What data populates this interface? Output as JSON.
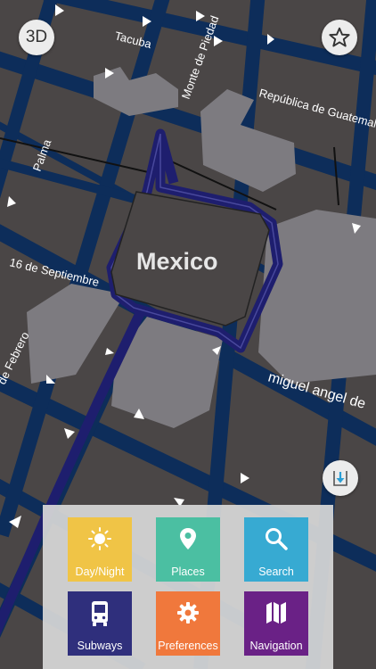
{
  "map": {
    "city_label": "Mexico",
    "streets": {
      "tacuba": "Tacuba",
      "monte_de_piedad": "Monte de Piedad",
      "republica": "República de Guatemala",
      "palma": "Palma",
      "sixteen_sept": "16 de Septiembre",
      "febrero": "de Febrero",
      "miguel_angel": "miguel angel de"
    },
    "colors": {
      "block": "#4a4646",
      "road": "#0d2d5a",
      "route": "#1e1e6e",
      "building": "#7e7d80"
    }
  },
  "controls": {
    "view_mode_label": "3D",
    "favorites_icon": "star-outline-icon",
    "download_icon": "download-tray-icon"
  },
  "menu": {
    "items": [
      {
        "label": "Day/Night",
        "icon": "sun-icon",
        "color": "#f0c446"
      },
      {
        "label": "Places",
        "icon": "pin-icon",
        "color": "#4bbfa2"
      },
      {
        "label": "Search",
        "icon": "magnifier-icon",
        "color": "#37aad2"
      },
      {
        "label": "Subways",
        "icon": "bus-icon",
        "color": "#2f2f7c"
      },
      {
        "label": "Preferences",
        "icon": "gear-icon",
        "color": "#f0783c"
      },
      {
        "label": "Navigation",
        "icon": "map-icon",
        "color": "#6a2186"
      }
    ]
  }
}
